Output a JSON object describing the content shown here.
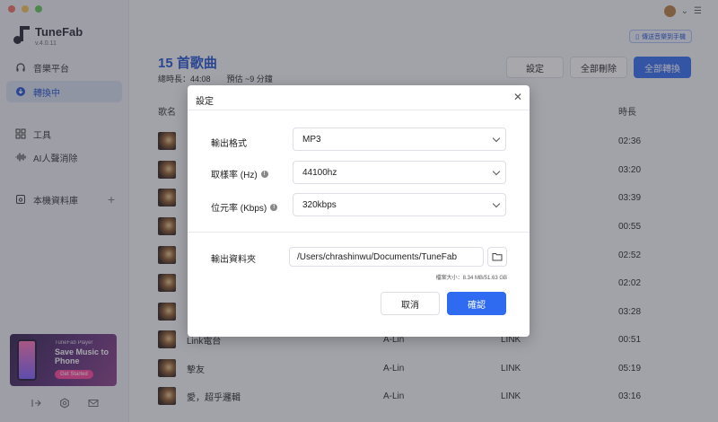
{
  "app": {
    "name": "TuneFab",
    "version": "v.4.0.11"
  },
  "sidebar": {
    "items": [
      {
        "label": "音樂平台",
        "icon": "headphones-icon"
      },
      {
        "label": "轉換中",
        "icon": "download-icon"
      },
      {
        "label": "工具",
        "icon": "grid-icon"
      },
      {
        "label": "AI人聲消除",
        "icon": "waveform-icon"
      },
      {
        "label": "本機資料庫",
        "icon": "library-icon"
      }
    ],
    "promo": {
      "small": "TuneFab Player",
      "big": "Save Music to Phone",
      "button": "Get Started"
    }
  },
  "header": {
    "transfer_button": "傳送音樂到手機",
    "title": "15 首歌曲",
    "subtitle": "總時長：44:08　　預估 ~9 分鐘",
    "settings_button": "設定",
    "delete_all_button": "全部刪除",
    "convert_all_button": "全部轉換"
  },
  "table": {
    "col_name": "歌名",
    "col_duration": "時長",
    "rows": [
      {
        "title": "",
        "artist": "",
        "album": "",
        "duration": "02:36"
      },
      {
        "title": "",
        "artist": "",
        "album": "",
        "duration": "03:20"
      },
      {
        "title": "",
        "artist": "",
        "album": "",
        "duration": "03:39"
      },
      {
        "title": "",
        "artist": "",
        "album": "",
        "duration": "00:55"
      },
      {
        "title": "",
        "artist": "",
        "album": "",
        "duration": "02:52"
      },
      {
        "title": "",
        "artist": "",
        "album": "",
        "duration": "02:02"
      },
      {
        "title": "",
        "artist": "",
        "album": "",
        "duration": "03:28"
      },
      {
        "title": "Link電台",
        "artist": "A-Lin",
        "album": "LINK",
        "duration": "00:51"
      },
      {
        "title": "摯友",
        "artist": "A-Lin",
        "album": "LINK",
        "duration": "05:19"
      },
      {
        "title": "愛，超乎邏輯",
        "artist": "A-Lin",
        "album": "LINK",
        "duration": "03:16"
      }
    ]
  },
  "dialog": {
    "title": "設定",
    "format_label": "輸出格式",
    "format_value": "MP3",
    "sample_label": "取樣率 (Hz)",
    "sample_value": "44100hz",
    "bitrate_label": "位元率 (Kbps)",
    "bitrate_value": "320kbps",
    "folder_label": "輸出資料夾",
    "folder_value": "/Users/chrashinwu/Documents/TuneFab",
    "size_note": "檔案大小：8.34 MB/51.63 GB",
    "cancel": "取消",
    "confirm": "確認"
  },
  "colors": {
    "accent": "#2f6bf1",
    "title_blue": "#1d4fd0"
  }
}
